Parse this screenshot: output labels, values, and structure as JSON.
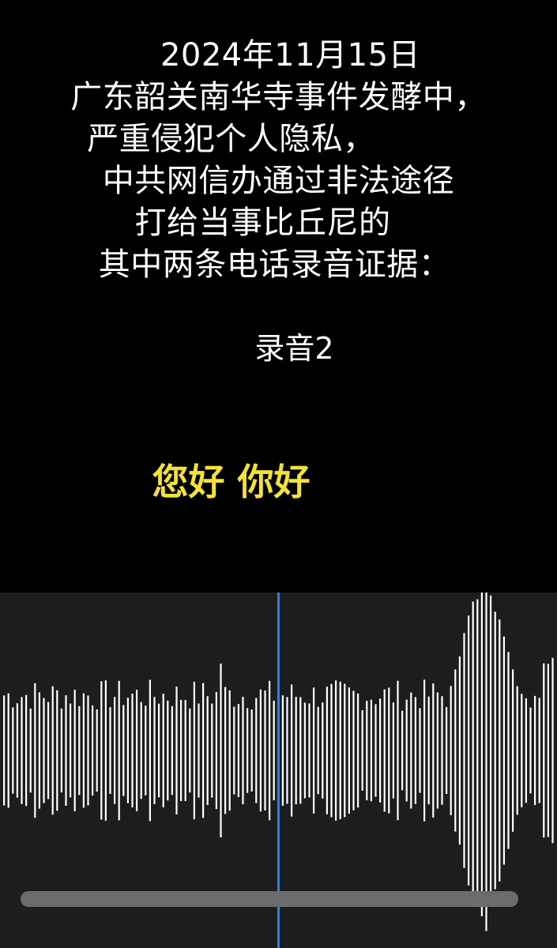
{
  "title_lines": [
    "2024年11月15日",
    "广东韶关南华寺事件发酵中，",
    "严重侵犯个人隐私，",
    "中共网信办通过非法途径",
    "打给当事比丘尼的",
    "其中两条电话录音证据："
  ],
  "recording_label": "录音2",
  "subtitle": "您好 你好",
  "colors": {
    "background": "#000000",
    "text": "#ffffff",
    "subtitle": "#f3e23a",
    "waveform_panel": "#1d1d1f",
    "waveform_bar": "#ffffff",
    "playhead": "#2f7fe0",
    "scrollbar": "#6b6b6e"
  },
  "player": {
    "playhead_position": 0.5
  }
}
